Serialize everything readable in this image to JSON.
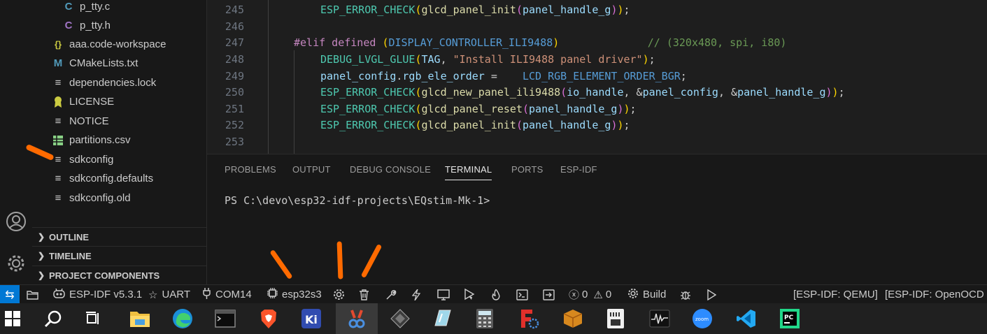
{
  "explorer": {
    "files": [
      {
        "icon": "C",
        "name": "p_tty.c"
      },
      {
        "icon": "C",
        "name": "p_tty.h"
      },
      {
        "icon": "{}",
        "name": "aaa.code-workspace"
      },
      {
        "icon": "M",
        "name": "CMakeLists.txt"
      },
      {
        "icon": "≡",
        "name": "dependencies.lock"
      },
      {
        "icon": "license",
        "name": "LICENSE"
      },
      {
        "icon": "≡",
        "name": "NOTICE"
      },
      {
        "icon": "csv",
        "name": "partitions.csv"
      },
      {
        "icon": "≡",
        "name": "sdkconfig"
      },
      {
        "icon": "≡",
        "name": "sdkconfig.defaults"
      },
      {
        "icon": "≡",
        "name": "sdkconfig.old"
      }
    ],
    "sections": [
      "OUTLINE",
      "TIMELINE",
      "PROJECT COMPONENTS"
    ]
  },
  "editor": {
    "line_numbers": [
      "245",
      "246",
      "247",
      "248",
      "249",
      "250",
      "251",
      "252",
      "253"
    ]
  },
  "panel": {
    "tabs": [
      "PROBLEMS",
      "OUTPUT",
      "DEBUG CONSOLE",
      "TERMINAL",
      "PORTS",
      "ESP-IDF"
    ],
    "active_tab": "TERMINAL",
    "terminal_prompt": "PS C:\\devo\\esp32-idf-projects\\EQstim-Mk-1>"
  },
  "statusbar": {
    "idf_version": "ESP-IDF v5.3.1",
    "uart": "UART",
    "port": "COM14",
    "target": "esp32s3",
    "errors": "0",
    "warnings": "0",
    "build": "Build",
    "qemu": "[ESP-IDF: QEMU]",
    "openocd": "[ESP-IDF: OpenOCD Se"
  },
  "colors": {
    "accent": "#0078d4",
    "annotation": "#ff6a00"
  }
}
